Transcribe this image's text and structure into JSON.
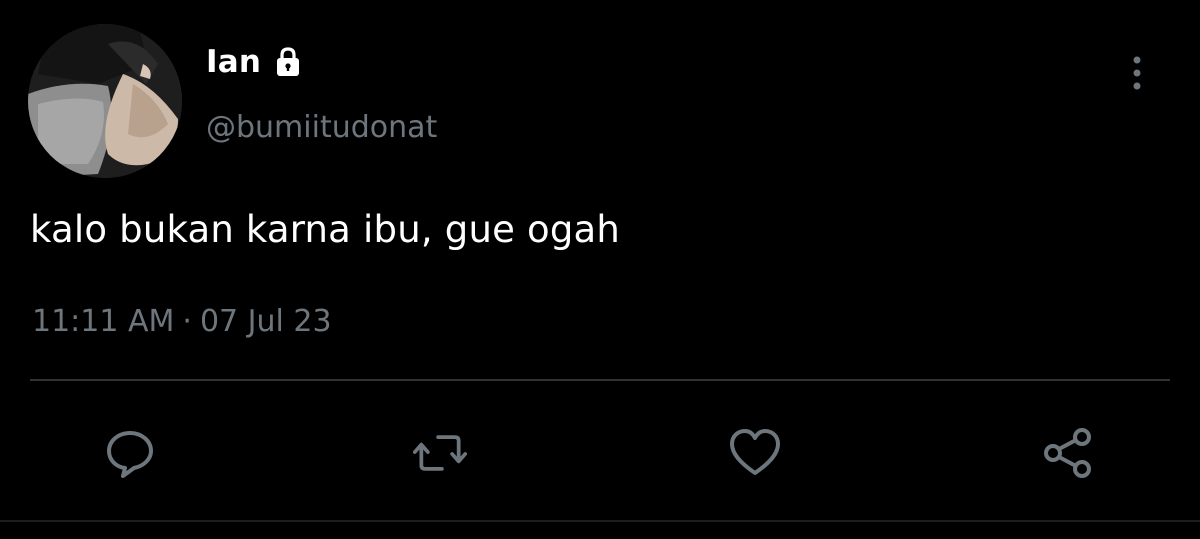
{
  "author": {
    "display_name": "Ian",
    "handle": "@bumiitudonat",
    "protected_icon": "lock-icon",
    "avatar_icon": "profile-photo"
  },
  "tweet": {
    "text": "kalo bukan karna ibu, gue ogah",
    "time": "11:11 AM",
    "separator": "·",
    "date": "07 Jul 23"
  },
  "actions": [
    {
      "name": "reply",
      "icon": "comment-icon"
    },
    {
      "name": "retweet",
      "icon": "retweet-icon"
    },
    {
      "name": "like",
      "icon": "heart-icon"
    },
    {
      "name": "share",
      "icon": "share-icon"
    }
  ],
  "menu": {
    "icon": "more-vertical-icon"
  },
  "colors": {
    "background": "#000000",
    "primary_text": "#ffffff",
    "secondary_text": "#6e767d",
    "divider": "#2f3336"
  }
}
